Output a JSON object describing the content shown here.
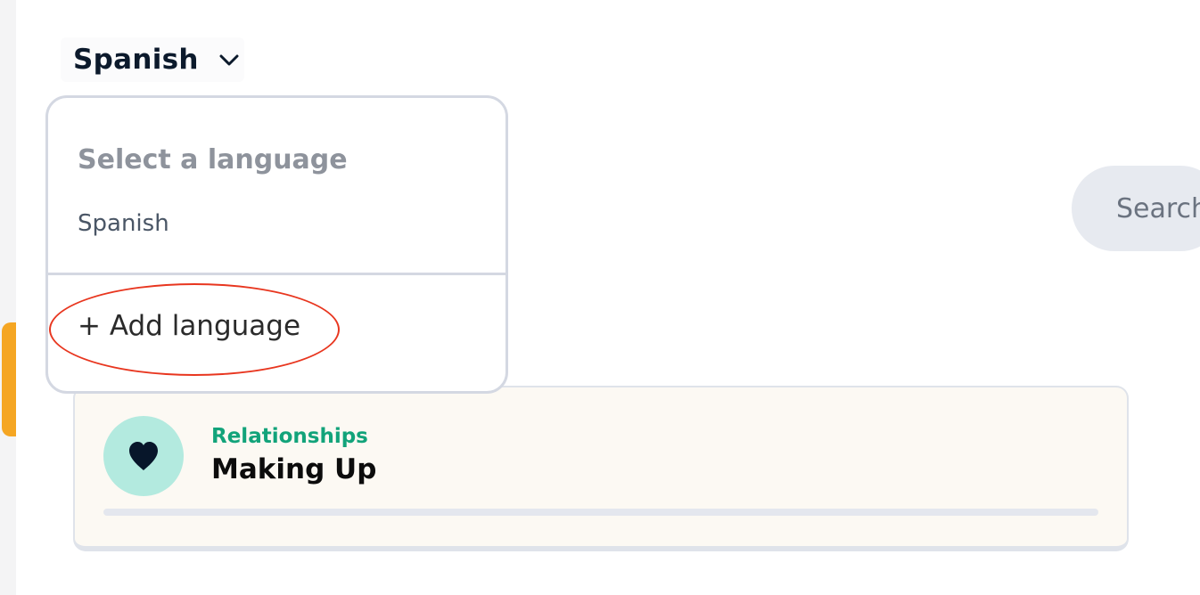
{
  "language_selector": {
    "selected": "Spanish"
  },
  "dropdown": {
    "header": "Select a language",
    "options": [
      "Spanish"
    ],
    "add_label": "+ Add language"
  },
  "search": {
    "placeholder": "Search"
  },
  "lesson_card": {
    "category": "Relationships",
    "title": "Making Up",
    "icon": "heart-icon",
    "progress": 0
  },
  "colors": {
    "accent_orange": "#f5a623",
    "category_green": "#12a37a",
    "highlight_red": "#e8361f"
  }
}
